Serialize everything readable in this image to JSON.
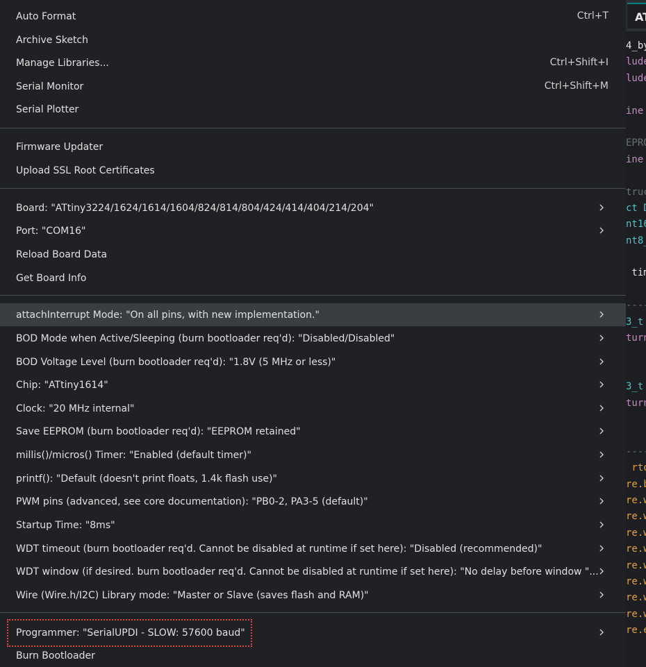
{
  "editor": {
    "tab_label": "AT",
    "code_fragments": [
      {
        "text": "4_by",
        "color": "#e8e8e8"
      },
      {
        "text": "lude",
        "color": "#c586c0"
      },
      {
        "text": "lude",
        "color": "#c586c0"
      },
      {
        "text": "",
        "color": "#e8e8e8"
      },
      {
        "text": "ine",
        "color": "#c586c0"
      },
      {
        "text": "",
        "color": "#e8e8e8"
      },
      {
        "text": "EPRO",
        "color": "#6a6f75"
      },
      {
        "text": "ine",
        "color": "#c586c0"
      },
      {
        "text": "",
        "color": "#e8e8e8"
      },
      {
        "text": "truc",
        "color": "#6a6f75"
      },
      {
        "text": "ct D",
        "color": "#4fc1c9"
      },
      {
        "text": "nt16",
        "color": "#4fc1c9"
      },
      {
        "text": "nt8_",
        "color": "#4fc1c9"
      },
      {
        "text": "",
        "color": "#e8e8e8"
      },
      {
        "text": " tim",
        "color": "#e8e8e8"
      },
      {
        "text": "",
        "color": "#e8e8e8"
      },
      {
        "text": "----",
        "color": "#6a6f75"
      },
      {
        "text": "3_t",
        "color": "#4fc1c9"
      },
      {
        "text": "turn",
        "color": "#c586c0"
      },
      {
        "text": "",
        "color": "#e8e8e8"
      },
      {
        "text": "",
        "color": "#e8e8e8"
      },
      {
        "text": "3_t",
        "color": "#4fc1c9"
      },
      {
        "text": "turn",
        "color": "#c586c0"
      },
      {
        "text": "",
        "color": "#e8e8e8"
      },
      {
        "text": "",
        "color": "#e8e8e8"
      },
      {
        "text": "----",
        "color": "#6a6f75"
      },
      {
        "text": " rto",
        "color": "#e2a13c"
      },
      {
        "text": "re.b",
        "color": "#e2a13c"
      },
      {
        "text": "re.w",
        "color": "#e2a13c"
      },
      {
        "text": "re.w",
        "color": "#e2a13c"
      },
      {
        "text": "re.w",
        "color": "#e2a13c"
      },
      {
        "text": "re.w",
        "color": "#e2a13c"
      },
      {
        "text": "re.w",
        "color": "#e2a13c"
      },
      {
        "text": "re.w",
        "color": "#e2a13c"
      },
      {
        "text": "re.w",
        "color": "#e2a13c"
      },
      {
        "text": "re.w",
        "color": "#e2a13c"
      },
      {
        "text": "re.e",
        "color": "#e2a13c"
      }
    ]
  },
  "menu": {
    "colors": {
      "background": "#202124",
      "highlight": "#3a3d41",
      "separator": "#4a4d51",
      "annotation": "#e0474a"
    },
    "groups": [
      {
        "items": [
          {
            "name": "menu-item-auto-format",
            "label": "Auto Format",
            "shortcut": "Ctrl+T"
          },
          {
            "name": "menu-item-archive-sketch",
            "label": "Archive Sketch"
          },
          {
            "name": "menu-item-manage-libraries",
            "label": "Manage Libraries...",
            "shortcut": "Ctrl+Shift+I"
          },
          {
            "name": "menu-item-serial-monitor",
            "label": "Serial Monitor",
            "shortcut": "Ctrl+Shift+M"
          },
          {
            "name": "menu-item-serial-plotter",
            "label": "Serial Plotter"
          }
        ]
      },
      {
        "items": [
          {
            "name": "menu-item-firmware-updater",
            "label": "Firmware Updater"
          },
          {
            "name": "menu-item-upload-ssl-root-certificates",
            "label": "Upload SSL Root Certificates"
          }
        ]
      },
      {
        "items": [
          {
            "name": "menu-item-board",
            "label": "Board: \"ATtiny3224/1624/1614/1604/824/814/804/424/414/404/214/204\"",
            "submenu": true
          },
          {
            "name": "menu-item-port",
            "label": "Port: \"COM16\"",
            "submenu": true
          },
          {
            "name": "menu-item-reload-board-data",
            "label": "Reload Board Data"
          },
          {
            "name": "menu-item-get-board-info",
            "label": "Get Board Info"
          }
        ]
      },
      {
        "items": [
          {
            "name": "menu-item-attachinterrupt-mode",
            "label": "attachInterrupt Mode: \"On all pins, with new implementation.\"",
            "submenu": true,
            "highlighted": true
          },
          {
            "name": "menu-item-bod-mode",
            "label": "BOD Mode when Active/Sleeping (burn bootloader req'd): \"Disabled/Disabled\"",
            "submenu": true
          },
          {
            "name": "menu-item-bod-voltage-level",
            "label": "BOD Voltage Level (burn bootloader req'd): \"1.8V (5 MHz or less)\"",
            "submenu": true
          },
          {
            "name": "menu-item-chip",
            "label": "Chip: \"ATtiny1614\"",
            "submenu": true
          },
          {
            "name": "menu-item-clock",
            "label": "Clock: \"20 MHz internal\"",
            "submenu": true
          },
          {
            "name": "menu-item-save-eeprom",
            "label": "Save EEPROM (burn bootloader req'd): \"EEPROM retained\"",
            "submenu": true
          },
          {
            "name": "menu-item-millis-timer",
            "label": "millis()/micros() Timer: \"Enabled (default timer)\"",
            "submenu": true
          },
          {
            "name": "menu-item-printf",
            "label": "printf(): \"Default (doesn't print floats, 1.4k flash use)\"",
            "submenu": true
          },
          {
            "name": "menu-item-pwm-pins",
            "label": "PWM pins (advanced, see core documentation): \"PB0-2, PA3-5 (default)\"",
            "submenu": true
          },
          {
            "name": "menu-item-startup-time",
            "label": "Startup Time: \"8ms\"",
            "submenu": true
          },
          {
            "name": "menu-item-wdt-timeout",
            "label": "WDT timeout (burn bootloader req'd. Cannot be disabled at runtime if set here): \"Disabled (recommended)\"",
            "submenu": true
          },
          {
            "name": "menu-item-wdt-window",
            "label": "WDT window (if desired. burn bootloader req'd. Cannot be disabled at runtime if set here): \"No delay before window \"...",
            "submenu": true
          },
          {
            "name": "menu-item-wire-library-mode",
            "label": "Wire (Wire.h/I2C) Library mode: \"Master or Slave (saves flash and RAM)\"",
            "submenu": true
          }
        ]
      },
      {
        "items": [
          {
            "name": "menu-item-programmer",
            "label": "Programmer: \"SerialUPDI - SLOW: 57600 baud\"",
            "submenu": true,
            "annotated": true
          },
          {
            "name": "menu-item-burn-bootloader",
            "label": "Burn Bootloader"
          }
        ]
      }
    ]
  }
}
